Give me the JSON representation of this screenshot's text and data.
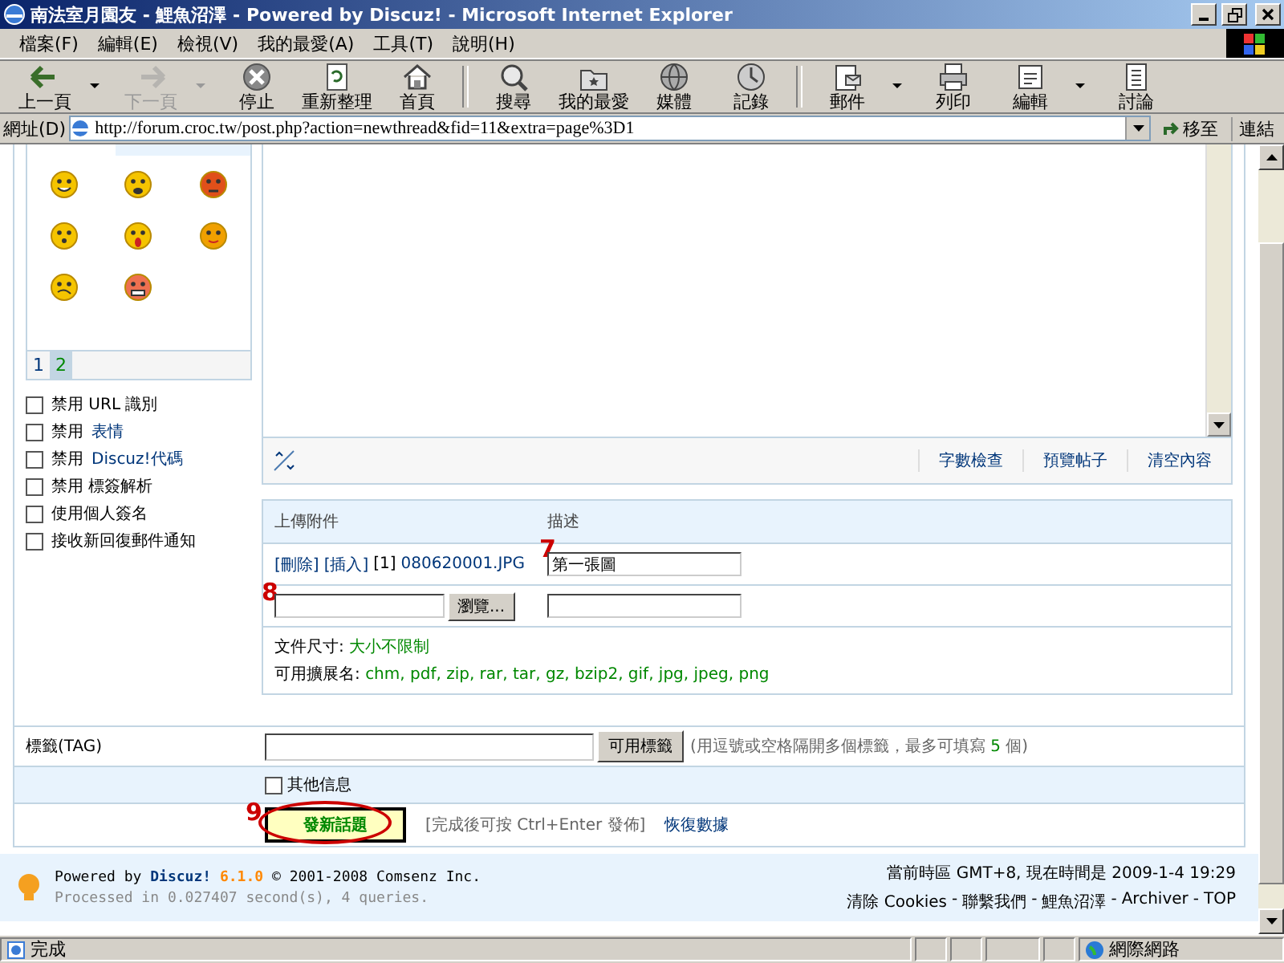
{
  "window": {
    "title": "南法室月園友 - 鯉魚沼澤 - Powered by Discuz! - Microsoft Internet Explorer"
  },
  "menu": [
    "檔案(F)",
    "編輯(E)",
    "檢視(V)",
    "我的最愛(A)",
    "工具(T)",
    "說明(H)"
  ],
  "toolbar": [
    {
      "kind": "back",
      "label": "上一頁",
      "disabled": false,
      "dropdown": true
    },
    {
      "kind": "forward",
      "label": "下一頁",
      "disabled": true,
      "dropdown": true
    },
    {
      "kind": "stop",
      "label": "停止",
      "disabled": false,
      "dropdown": false
    },
    {
      "kind": "refresh",
      "label": "重新整理",
      "disabled": false,
      "dropdown": false
    },
    {
      "kind": "home",
      "label": "首頁",
      "disabled": false,
      "dropdown": false
    },
    {
      "kind": "search",
      "label": "搜尋",
      "disabled": false,
      "dropdown": false
    },
    {
      "kind": "favorites",
      "label": "我的最愛",
      "disabled": false,
      "dropdown": false
    },
    {
      "kind": "media",
      "label": "媒體",
      "disabled": false,
      "dropdown": false
    },
    {
      "kind": "history",
      "label": "記錄",
      "disabled": false,
      "dropdown": false
    },
    {
      "kind": "mail",
      "label": "郵件",
      "disabled": false,
      "dropdown": true
    },
    {
      "kind": "print",
      "label": "列印",
      "disabled": false,
      "dropdown": false
    },
    {
      "kind": "edit",
      "label": "編輯",
      "disabled": false,
      "dropdown": true
    },
    {
      "kind": "discuss",
      "label": "討論",
      "disabled": false,
      "dropdown": false
    }
  ],
  "address": {
    "label": "網址(D)",
    "url": "http://forum.croc.tw/post.php?action=newthread&fid=11&extra=page%3D1",
    "go": "移至",
    "links": "連結"
  },
  "smilies": {
    "pages": [
      {
        "label": "1",
        "selected": false
      },
      {
        "label": "2",
        "selected": true
      }
    ]
  },
  "options": [
    {
      "text": "禁用 URL 識別",
      "checked": false
    },
    {
      "text": "禁用",
      "link": "表情",
      "checked": false
    },
    {
      "text": "禁用",
      "link": "Discuz!代碼",
      "checked": false
    },
    {
      "text": "禁用 標簽解析",
      "checked": false
    },
    {
      "text": "使用個人簽名",
      "checked": false
    },
    {
      "text": "接收新回復郵件通知",
      "checked": false
    }
  ],
  "editor": {
    "links": [
      "字數檢查",
      "預覽帖子",
      "清空內容"
    ]
  },
  "attachments": {
    "columns": [
      "上傳附件",
      "描述"
    ],
    "rows": [
      {
        "actions": [
          "[刪除]",
          "[插入]"
        ],
        "index": "[1]",
        "file": "080620001.JPG",
        "description": "第一張圖",
        "marker": "7"
      }
    ],
    "new_row": {
      "browse": "瀏覽...",
      "marker": "8"
    },
    "size_label": "文件尺寸:",
    "size_value": "大小不限制",
    "ext_label": "可用擴展名:",
    "ext_value": "chm, pdf, zip, rar, tar, gz, bzip2, gif, jpg, jpeg, png"
  },
  "tag": {
    "label": "標籤(TAG)",
    "button": "可用標籤",
    "hint_before": "(用逗號或空格隔開多個標籤，最多可填寫",
    "hint_count": "5",
    "hint_after": "個)"
  },
  "other_info": {
    "label": "其他信息",
    "checked": false
  },
  "submit": {
    "button": "發新話題",
    "marker": "9",
    "hint": "[完成後可按 Ctrl+Enter 發佈]",
    "restore": "恢復數據"
  },
  "footer": {
    "powered": "Powered by",
    "brand": "Discuz!",
    "version": "6.1.0",
    "copyright": "© 2001-2008 Comsenz Inc.",
    "processed": "Processed in 0.027407 second(s), 4 queries.",
    "time": "當前時區 GMT+8, 現在時間是 2009-1-4 19:29",
    "separator": "-",
    "links": [
      "清除 Cookies",
      "聯繫我們",
      "鯉魚沼澤",
      "Archiver",
      "TOP"
    ]
  },
  "status": {
    "text": "完成",
    "zone": "網際網路"
  }
}
